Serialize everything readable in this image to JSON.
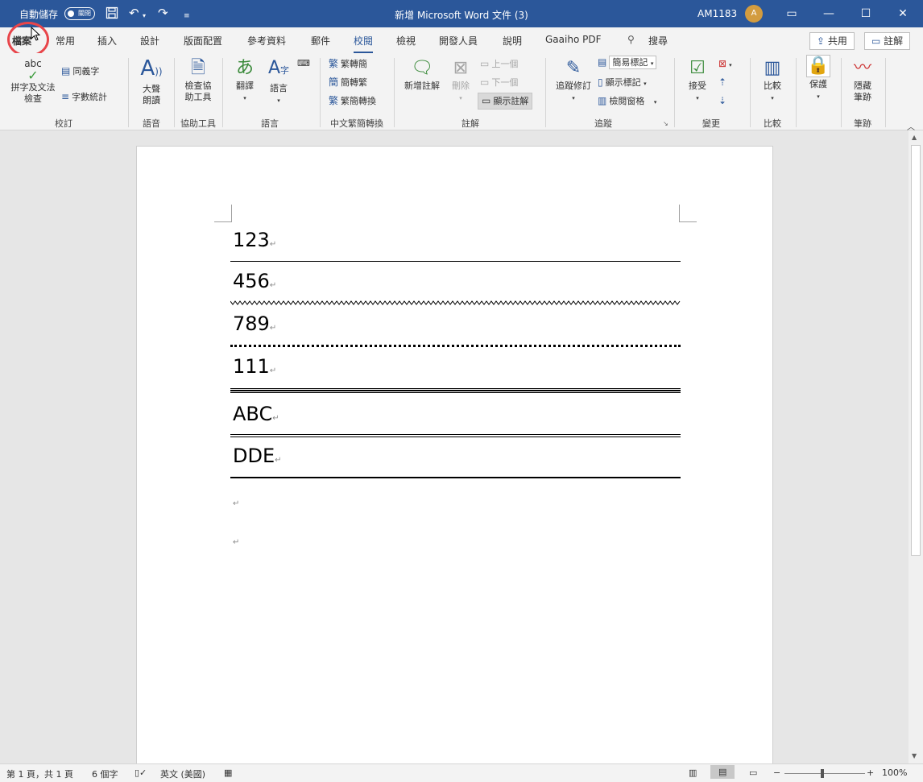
{
  "titlebar": {
    "autosave_label": "自動儲存",
    "autosave_state": "關閉",
    "document_title": "新增 Microsoft Word 文件 (3)",
    "user_name": "AM1183",
    "avatar_initial": "A",
    "icons": [
      "save-icon",
      "undo-icon",
      "redo-icon",
      "customize-qat-icon",
      "ribbon-display-icon",
      "minimize-icon",
      "maximize-icon",
      "close-icon"
    ]
  },
  "tabs": {
    "items": [
      "檔案",
      "常用",
      "插入",
      "設計",
      "版面配置",
      "參考資料",
      "郵件",
      "校閱",
      "檢視",
      "開發人員",
      "說明",
      "Gaaiho PDF"
    ],
    "active": "校閱",
    "search_label": "搜尋",
    "share_label": "共用",
    "comments_label": "註解"
  },
  "ribbon": {
    "proofing": {
      "group_label": "校訂",
      "spelling_icon_text": "abc",
      "spelling_label": "拼字及文法檢查",
      "thesaurus_label": "同義字",
      "wordcount_label": "字數統計"
    },
    "speech": {
      "group_label": "語音",
      "read_aloud_label": "大聲朗讀"
    },
    "accessibility": {
      "group_label": "協助工具",
      "check_label": "檢查協助工具"
    },
    "language": {
      "group_label": "語言",
      "translate_label": "翻譯",
      "language_label": "語言"
    },
    "chinese_conversion": {
      "group_label": "中文繁簡轉換",
      "trad_to_simp": "繁轉簡",
      "simp_to_trad": "簡轉繁",
      "convert": "繁簡轉換"
    },
    "comments": {
      "group_label": "註解",
      "new_comment": "新增註解",
      "delete": "刪除",
      "previous": "上一個",
      "next": "下一個",
      "show_comments": "顯示註解"
    },
    "tracking": {
      "group_label": "追蹤",
      "track_changes": "追蹤修訂",
      "markup_view": "簡易標記",
      "show_markup": "顯示標記",
      "reviewing_pane": "檢閱窗格"
    },
    "changes": {
      "group_label": "變更",
      "accept_label": "接受"
    },
    "compare": {
      "group_label": "比較",
      "compare_label": "比較"
    },
    "protect": {
      "protect_label": "保護"
    },
    "ink": {
      "group_label": "筆跡",
      "hide_ink_label": "隱藏筆跡"
    }
  },
  "document": {
    "lines": [
      "123",
      "456",
      "789",
      "111",
      "ABC",
      "DDE"
    ],
    "paragraph_mark": "↵"
  },
  "statusbar": {
    "page_info": "第 1 頁，共 1 頁",
    "word_count": "6 個字",
    "language": "英文 (美國)",
    "zoom_level": "100%",
    "zoom_percent": 100
  }
}
